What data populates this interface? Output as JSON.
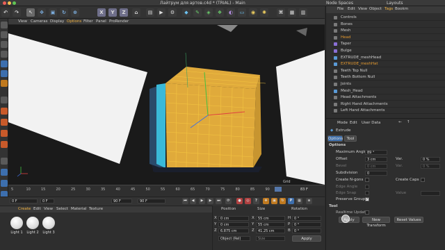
{
  "titlebar": {
    "title": "Лайтрум  для артов.c4d * (TRIAL) - Main",
    "node_spaces": "Node Spaces",
    "layouts": "Layouts"
  },
  "toolbar": {
    "axis_x": "X",
    "axis_y": "Y",
    "axis_z": "Z"
  },
  "viewport": {
    "menu": [
      "View",
      "Cameras",
      "Display",
      "Options",
      "Filter",
      "Panel",
      "ProRender"
    ],
    "grid_label": "Grid"
  },
  "timeline": {
    "ticks": [
      "5",
      "10",
      "15",
      "20",
      "25",
      "30",
      "35",
      "40",
      "45",
      "50",
      "55",
      "60",
      "65",
      "70",
      "75",
      "80",
      "85",
      "90"
    ],
    "current_frame": "83 F"
  },
  "transport": {
    "start": "0 F",
    "current": "0 F",
    "end": "90 F",
    "end2": "90 F"
  },
  "materials": {
    "menu": [
      "Create",
      "Edit",
      "View",
      "Select",
      "Material",
      "Texture"
    ],
    "items": [
      "Light 1",
      "Light 2",
      "Light 3"
    ]
  },
  "coords": {
    "position": "Position",
    "size": "Size",
    "rotation": "Rotation",
    "rows": [
      {
        "axis": "X",
        "pos": "0 cm",
        "size_axis": "X",
        "size": "55 cm",
        "rot_axis": "H",
        "rot": "0 °"
      },
      {
        "axis": "Y",
        "pos": "0 cm",
        "size_axis": "Y",
        "size": "55 cm",
        "rot_axis": "P",
        "rot": "0 °"
      },
      {
        "axis": "Z",
        "pos": "6.875 cm",
        "size_axis": "Z",
        "size": "41.25 cm",
        "rot_axis": "B",
        "rot": "0 °"
      }
    ],
    "mode": "Object (Rel)",
    "size_mode": "Size",
    "apply": "Apply"
  },
  "objects": {
    "menu": [
      "File",
      "Edit",
      "View",
      "Object",
      "Tags",
      "Bookm"
    ],
    "items": [
      {
        "name": "Controls",
        "color": "#cccccc",
        "icon": "#7a7a7a"
      },
      {
        "name": "Bones",
        "color": "#cccccc",
        "icon": "#7a7a7a"
      },
      {
        "name": "Mesh",
        "color": "#cccccc",
        "icon": "#7a7a7a"
      },
      {
        "name": "Head",
        "color": "#e59a2f",
        "icon": "#7a7a7a"
      },
      {
        "name": "Taper",
        "color": "#cccccc",
        "icon": "#8a6fd6"
      },
      {
        "name": "Bulge",
        "color": "#cccccc",
        "icon": "#8a6fd6"
      },
      {
        "name": "EXTRUDE_meshHead",
        "color": "#cccccc",
        "icon": "#5a9ad6"
      },
      {
        "name": "EXTRUDE_meshHat",
        "color": "#e59a2f",
        "icon": "#5a9ad6"
      },
      {
        "name": "Teeth Top Null",
        "color": "#cccccc",
        "icon": "#7a7a7a"
      },
      {
        "name": "Teeth Bottom Null",
        "color": "#cccccc",
        "icon": "#7a7a7a"
      },
      {
        "name": "Joints",
        "color": "#cccccc",
        "icon": "#7a7a7a"
      },
      {
        "name": "Mesh_Head",
        "color": "#cccccc",
        "icon": "#5a9ad6"
      },
      {
        "name": "Head Attachments",
        "color": "#cccccc",
        "icon": "#7a7a7a"
      },
      {
        "name": "Right Hand Attachments",
        "color": "#cccccc",
        "icon": "#7a7a7a"
      },
      {
        "name": "Left Hand Attachments",
        "color": "#cccccc",
        "icon": "#7a7a7a"
      }
    ]
  },
  "attributes": {
    "menu": [
      "Mode",
      "Edit",
      "User Data"
    ],
    "object": "Extrude",
    "tabs": [
      "Options",
      "Tool"
    ],
    "section": "Options",
    "max_angle_label": "Maximum Angle",
    "max_angle": "89 °",
    "offset_label": "Offset",
    "offset": "3 cm",
    "var_label": "Var.",
    "var": "0 %",
    "bevel_label": "Bevel",
    "bevel": "0 cm",
    "var2_label": "Var.",
    "var2": "0 %",
    "subdivision_label": "Subdivision",
    "subdivision": "0",
    "create_ngons": "Create N-gons",
    "create_caps": "Create Caps",
    "edge_angle_label": "Edge Angle",
    "edge_angle": "",
    "edge_snap_label": "Edge Snap",
    "edge_snap": "",
    "value_label": "Value",
    "value": "",
    "preserve_groups": "Preserve Groups",
    "tool_section": "Tool",
    "realtime_update": "Realtime Update",
    "apply": "Apply",
    "new_transform": "New Transform",
    "reset_values": "Reset Values"
  }
}
